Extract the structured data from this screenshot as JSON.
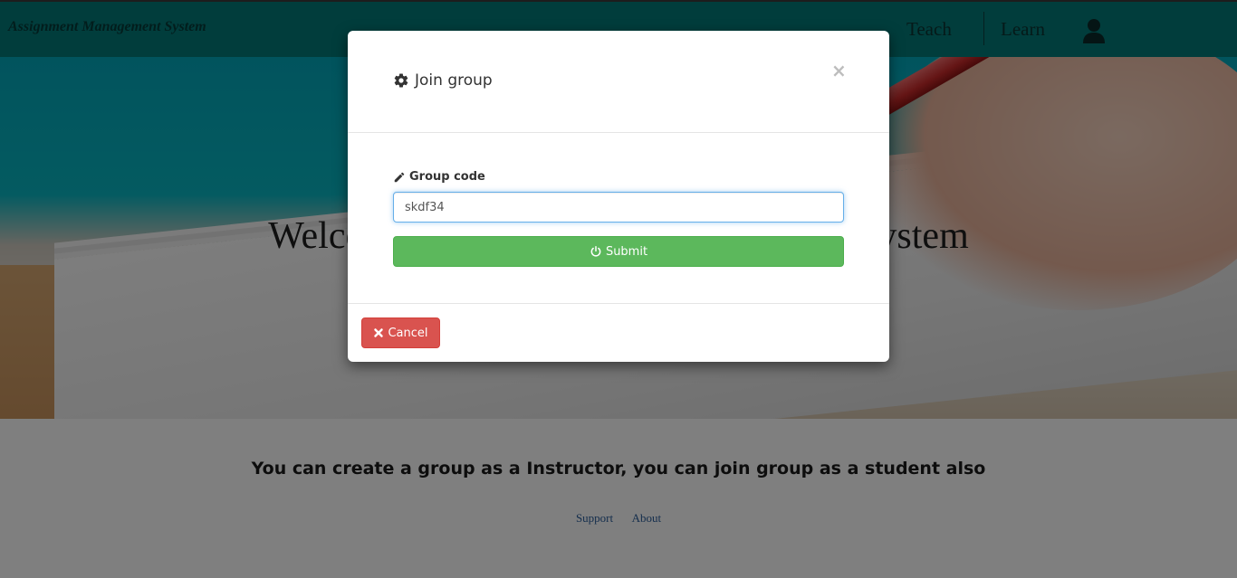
{
  "navbar": {
    "brand": "Assignment Management System",
    "links": [
      {
        "label": "Teach"
      },
      {
        "label": "Learn"
      }
    ],
    "user_icon": "user-icon",
    "background_color": "#027a79"
  },
  "hero": {
    "title": "Welcome to Assignment Management System"
  },
  "main": {
    "tagline": "You can create a group as a Instructor, you can join group as a student also"
  },
  "footer": {
    "links": [
      {
        "label": "Support"
      },
      {
        "label": "About"
      }
    ]
  },
  "modal": {
    "title": "Join group",
    "title_icon": "gear-icon",
    "close_label": "×",
    "field_label": "Group code",
    "field_icon": "pencil-icon",
    "group_code_value": "skdf34",
    "submit_label": "Submit",
    "submit_icon": "power-icon",
    "cancel_label": "Cancel",
    "cancel_icon": "times-icon"
  },
  "colors": {
    "submit": "#5cb85c",
    "cancel": "#d9534f",
    "input_focus": "#66afe9"
  }
}
